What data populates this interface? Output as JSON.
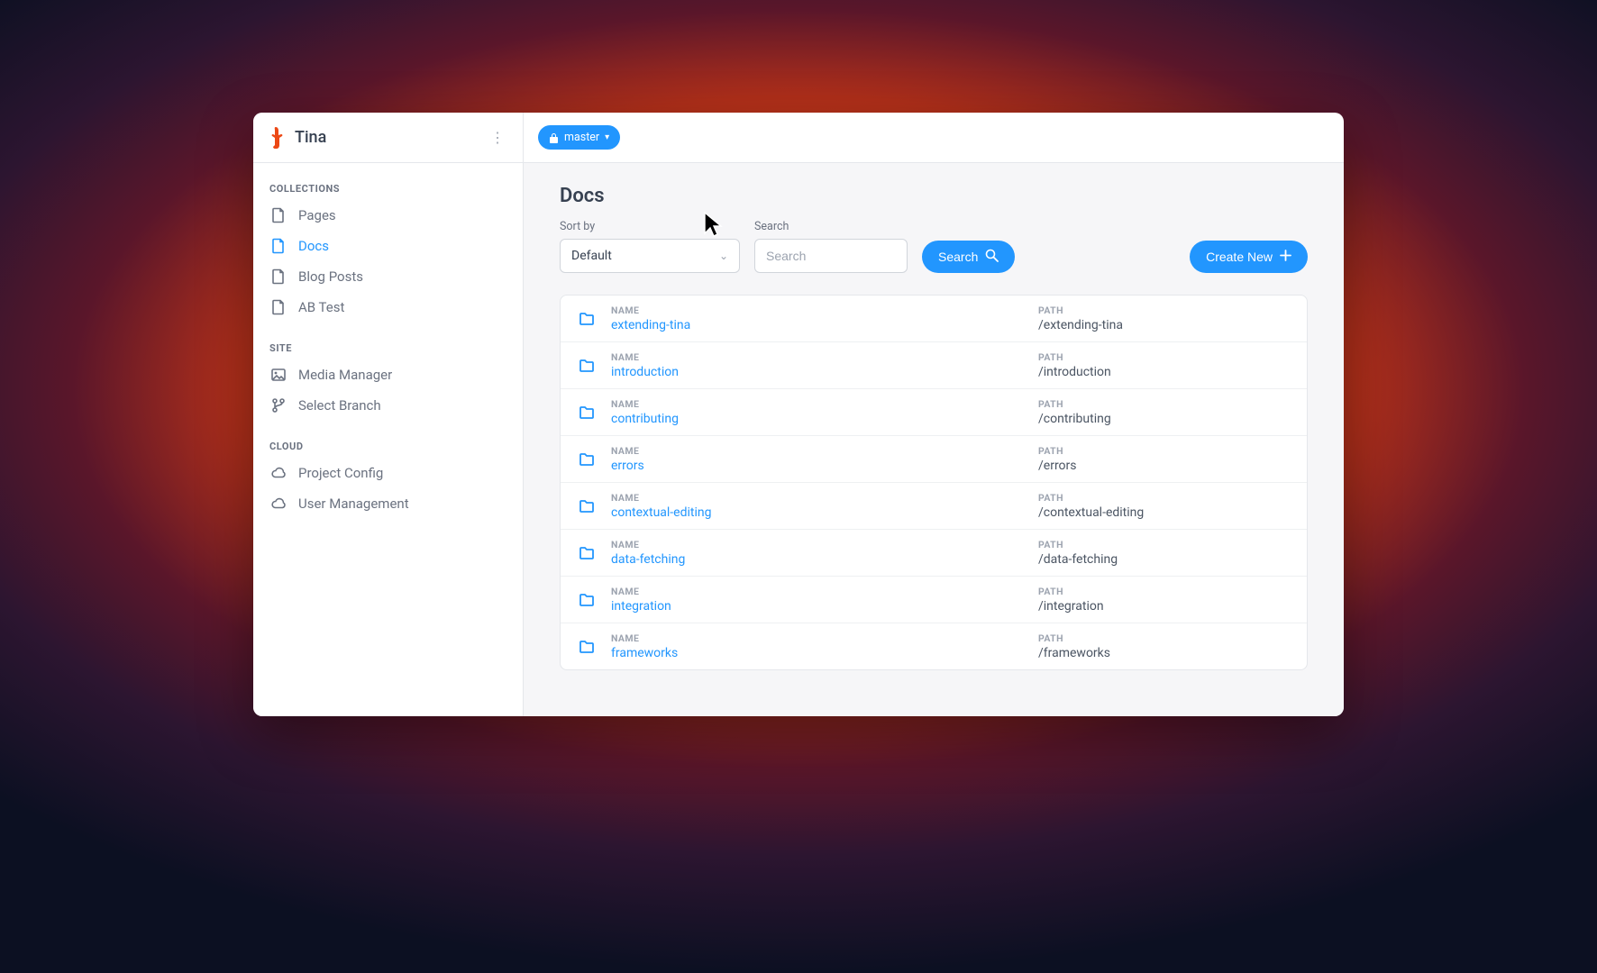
{
  "app": {
    "title": "Tina"
  },
  "sidebar": {
    "sections": [
      {
        "label": "COLLECTIONS",
        "items": [
          {
            "label": "Pages",
            "icon": "page",
            "active": false
          },
          {
            "label": "Docs",
            "icon": "page",
            "active": true
          },
          {
            "label": "Blog Posts",
            "icon": "page",
            "active": false
          },
          {
            "label": "AB Test",
            "icon": "page",
            "active": false
          }
        ]
      },
      {
        "label": "SITE",
        "items": [
          {
            "label": "Media Manager",
            "icon": "media",
            "active": false
          },
          {
            "label": "Select Branch",
            "icon": "branch",
            "active": false
          }
        ]
      },
      {
        "label": "CLOUD",
        "items": [
          {
            "label": "Project Config",
            "icon": "cloud",
            "active": false
          },
          {
            "label": "User Management",
            "icon": "cloud",
            "active": false
          }
        ]
      }
    ]
  },
  "topbar": {
    "branch": "master"
  },
  "page": {
    "title": "Docs",
    "sort_by_label": "Sort by",
    "sort_by_value": "Default",
    "search_label": "Search",
    "search_placeholder": "Search",
    "search_button": "Search",
    "create_button": "Create New"
  },
  "table": {
    "col_name_label": "NAME",
    "col_path_label": "PATH",
    "rows": [
      {
        "name": "extending-tina",
        "path": "/extending-tina"
      },
      {
        "name": "introduction",
        "path": "/introduction"
      },
      {
        "name": "contributing",
        "path": "/contributing"
      },
      {
        "name": "errors",
        "path": "/errors"
      },
      {
        "name": "contextual-editing",
        "path": "/contextual-editing"
      },
      {
        "name": "data-fetching",
        "path": "/data-fetching"
      },
      {
        "name": "integration",
        "path": "/integration"
      },
      {
        "name": "frameworks",
        "path": "/frameworks"
      }
    ]
  },
  "colors": {
    "accent": "#2296fe",
    "logo": "#ec4815"
  }
}
